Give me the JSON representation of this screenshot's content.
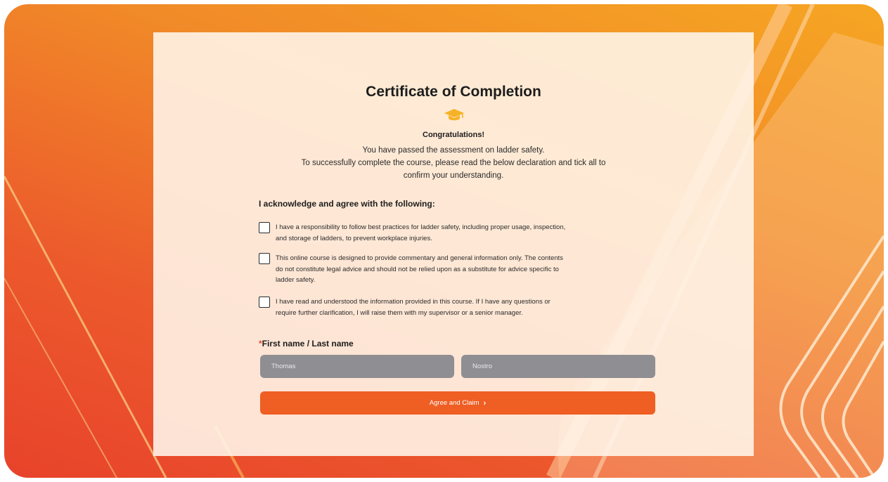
{
  "certificate": {
    "title": "Certificate of Completion",
    "icon": "graduation-cap-icon",
    "congrats": "Congratulations!",
    "intro_line1": "You have passed the assessment on ladder safety.",
    "intro_line2": "To successfully complete the course, please read the below declaration and tick all to",
    "intro_line3": "confirm your understanding."
  },
  "acknowledgement": {
    "heading": "I acknowledge and agree with the following:",
    "items": [
      {
        "checked": false,
        "lines": [
          "I have a responsibility to follow best practices for ladder safety, including proper usage, inspection,",
          "and storage of ladders, to prevent workplace injuries."
        ]
      },
      {
        "checked": false,
        "lines": [
          "This online course is designed to provide commentary and general information only. The contents",
          "do not constitute legal advice and should not be relied upon as a substitute for advice specific to",
          "ladder safety."
        ]
      },
      {
        "checked": false,
        "lines": [
          "I have read and understood the information provided in this course. If I have any questions or",
          "require further clarification, I will raise them with my supervisor or a senior manager."
        ]
      }
    ]
  },
  "name_field": {
    "required_mark": "*",
    "label": "First name / Last name",
    "first_name_value": "Thomas",
    "last_name_value": "Nostro"
  },
  "submit": {
    "label": "Agree and Claim",
    "chevron": "›"
  },
  "colors": {
    "accent": "#ef5e23",
    "icon": "#f6b226",
    "input_bg": "#8f8e92"
  }
}
